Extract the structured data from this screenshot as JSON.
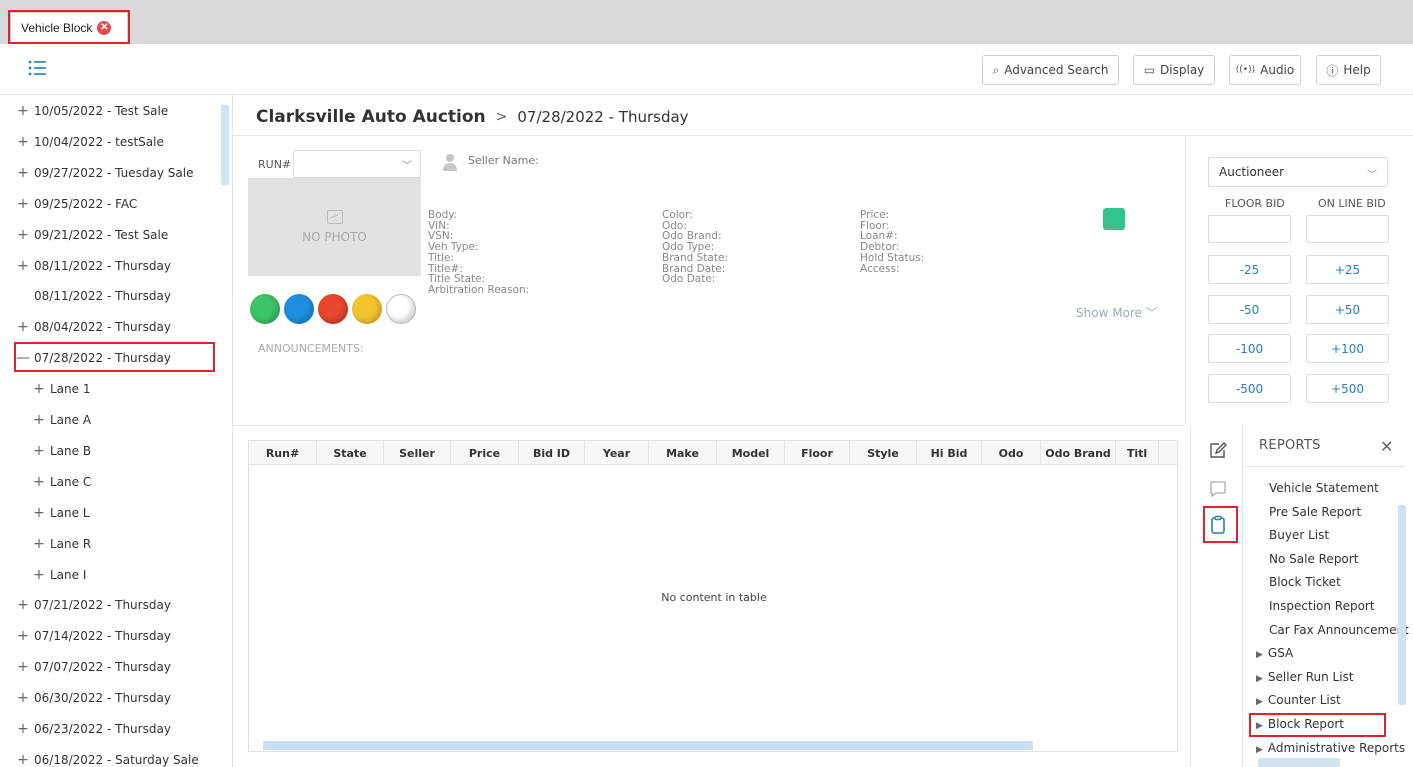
{
  "tab": {
    "label": "Vehicle Block",
    "close_glyph": "✕"
  },
  "toolbar": {
    "advanced_search": "Advanced Search",
    "display": "Display",
    "audio": "Audio",
    "help": "Help"
  },
  "tree": {
    "items": [
      {
        "pm": "+",
        "label": "10/05/2022 - Test Sale"
      },
      {
        "pm": "+",
        "label": "10/04/2022 - testSale"
      },
      {
        "pm": "+",
        "label": "09/27/2022 - Tuesday Sale"
      },
      {
        "pm": "+",
        "label": "09/25/2022 - FAC"
      },
      {
        "pm": "+",
        "label": "09/21/2022 - Test Sale"
      },
      {
        "pm": "+",
        "label": "08/11/2022 - Thursday"
      },
      {
        "pm": "",
        "label": "08/11/2022 - Thursday"
      },
      {
        "pm": "+",
        "label": "08/04/2022 - Thursday"
      },
      {
        "pm": "—",
        "label": "07/28/2022 - Thursday"
      },
      {
        "pm": "+",
        "label": "Lane 1"
      },
      {
        "pm": "+",
        "label": "Lane A"
      },
      {
        "pm": "+",
        "label": "Lane B"
      },
      {
        "pm": "+",
        "label": "Lane C"
      },
      {
        "pm": "+",
        "label": "Lane L"
      },
      {
        "pm": "+",
        "label": "Lane R"
      },
      {
        "pm": "+",
        "label": "Lane I"
      },
      {
        "pm": "+",
        "label": "07/21/2022 - Thursday"
      },
      {
        "pm": "+",
        "label": "07/14/2022 - Thursday"
      },
      {
        "pm": "+",
        "label": "07/07/2022 - Thursday"
      },
      {
        "pm": "+",
        "label": "06/30/2022 - Thursday"
      },
      {
        "pm": "+",
        "label": "06/23/2022 - Thursday"
      },
      {
        "pm": "+",
        "label": "06/18/2022 - Saturday Sale"
      }
    ]
  },
  "breadcrumb": {
    "auction": "Clarksville Auto Auction",
    "separator": ">",
    "sale": "07/28/2022 - Thursday"
  },
  "detail": {
    "run_label": "RUN#",
    "seller_name": "Seller Name:",
    "no_photo": "NO PHOTO",
    "col1": [
      "Body:",
      "VIN:",
      "VSN:",
      "Veh Type:",
      "Title:",
      "Title#:",
      "Title State:",
      "Arbitration Reason:"
    ],
    "col2": [
      "Color:",
      "Odo:",
      "Odo Brand:",
      "Odo Type:",
      "Brand State:",
      "Brand Date:",
      "Odo Date:"
    ],
    "col3": [
      "Price:",
      "Floor:",
      "Loan#:",
      "Debtor:",
      "Hold Status:",
      "Access:"
    ],
    "show_more": "Show More ﹀",
    "announcements": "ANNOUNCEMENTS:",
    "status_colors": [
      "#3cc468",
      "#1e8fe0",
      "#e8452c",
      "#f4c430",
      "#ffffff"
    ],
    "status_square_color": "#31c48d"
  },
  "bid": {
    "role": "Auctioneer",
    "floor_label": "FLOOR BID",
    "online_label": "ON LINE BID",
    "rows": [
      [
        "-25",
        "+25"
      ],
      [
        "-50",
        "+50"
      ],
      [
        "-100",
        "+100"
      ],
      [
        "-500",
        "+500"
      ]
    ]
  },
  "table": {
    "columns": [
      "Run#",
      "State",
      "Seller",
      "Price",
      "Bid ID",
      "Year",
      "Make",
      "Model",
      "Floor",
      "Style",
      "Hi Bid",
      "Odo",
      "Odo Brand",
      "Titl"
    ],
    "empty": "No content in table"
  },
  "reports": {
    "title": "REPORTS",
    "close": "✕",
    "items": [
      {
        "tri": "",
        "label": "Vehicle Statement"
      },
      {
        "tri": "",
        "label": "Pre Sale Report"
      },
      {
        "tri": "",
        "label": "Buyer List"
      },
      {
        "tri": "",
        "label": "No Sale Report"
      },
      {
        "tri": "",
        "label": "Block Ticket"
      },
      {
        "tri": "",
        "label": "Inspection Report"
      },
      {
        "tri": "",
        "label": "Car Fax Announcement"
      },
      {
        "tri": "▶",
        "label": "GSA"
      },
      {
        "tri": "▶",
        "label": "Seller Run List"
      },
      {
        "tri": "▶",
        "label": "Counter List"
      },
      {
        "tri": "▶",
        "label": "Block Report"
      },
      {
        "tri": "▶",
        "label": "Administrative Reports"
      }
    ]
  },
  "colors": {
    "accent": "#2a7fb8",
    "highlight": "#d9262c",
    "tab_bar": "#d9d9d9"
  }
}
